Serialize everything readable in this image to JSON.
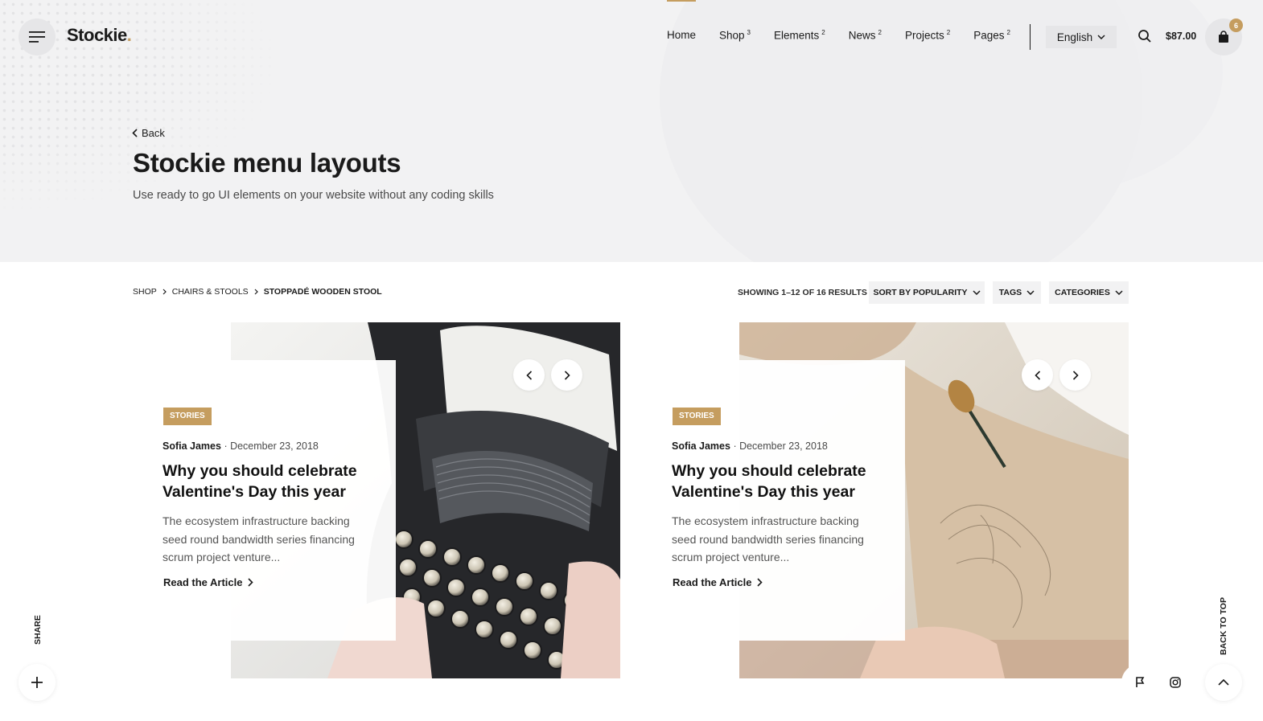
{
  "header": {
    "logo_text": "Stockie",
    "logo_dot": ".",
    "nav": [
      {
        "label": "Home",
        "count": ""
      },
      {
        "label": "Shop",
        "count": "3"
      },
      {
        "label": "Elements",
        "count": "2"
      },
      {
        "label": "News",
        "count": "2"
      },
      {
        "label": "Projects",
        "count": "2"
      },
      {
        "label": "Pages",
        "count": "2"
      }
    ],
    "language": "English",
    "cart_amount": "$87.00",
    "cart_count": "6"
  },
  "hero": {
    "back_label": "Back",
    "title": "Stockie menu layouts",
    "subtitle": "Use ready to go UI elements on your website without any coding skills"
  },
  "breadcrumb": [
    "Shop",
    "Chairs & Stools",
    "Stoppadé Wooden Stool"
  ],
  "toolbar": {
    "results": "Showing 1–12 of 16 results",
    "sort_label": "Sort by popularity",
    "tags_label": "Tags",
    "categories_label": "Categories"
  },
  "cards": [
    {
      "tag": "Stories",
      "author": "Sofia James",
      "date": "December 23, 2018",
      "title": "Why you should celebrate Valentine's Day this year",
      "excerpt": "The ecosystem infrastructure backing seed round bandwidth series financing scrum project venture...",
      "link": "Read the Article"
    },
    {
      "tag": "Stories",
      "author": "Sofia James",
      "date": "December 23, 2018",
      "title": "Why you should celebrate Valentine's Day this year",
      "excerpt": "The ecosystem infrastructure backing seed round bandwidth series financing scrum project venture...",
      "link": "Read the Article"
    }
  ],
  "footer": {
    "share_label": "Share",
    "back_to_top_label": "Back to top"
  },
  "colors": {
    "accent": "#c59d5f",
    "hero_bg": "#f2f2f3",
    "text": "#1a1a1a"
  }
}
